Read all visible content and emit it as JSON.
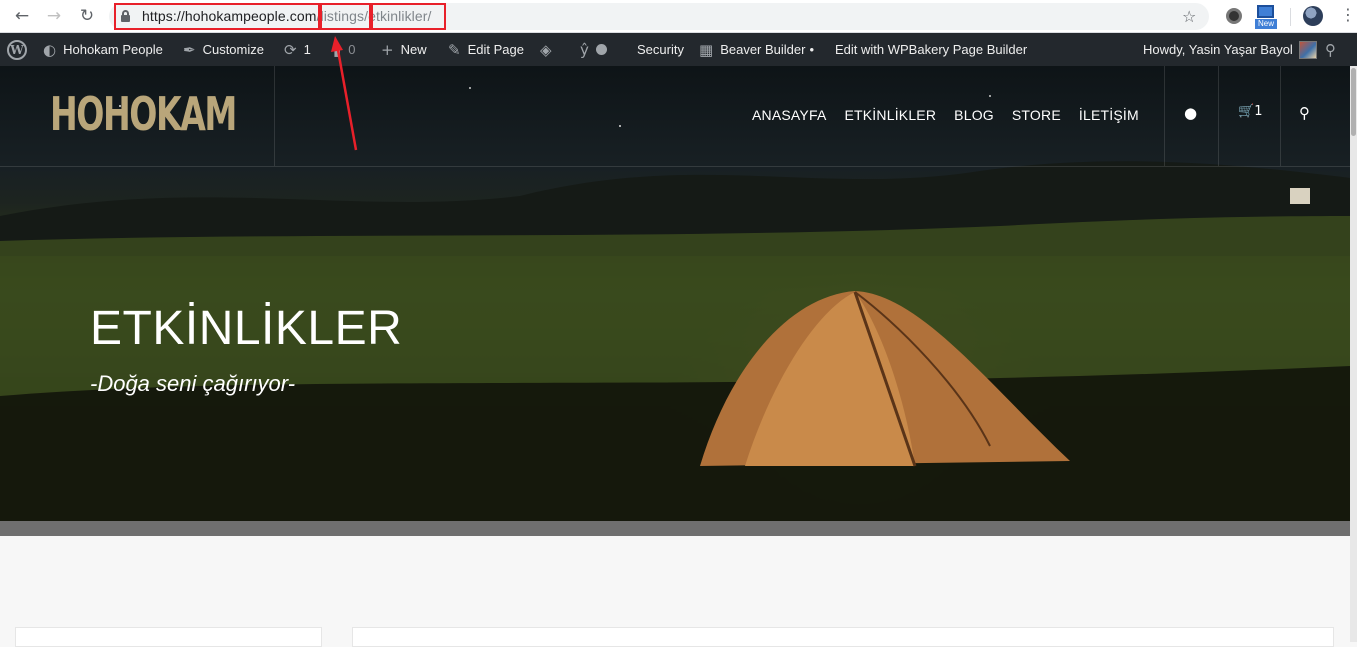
{
  "browser": {
    "back_icon": "arrow-left-icon",
    "forward_icon": "arrow-right-icon",
    "reload_icon": "reload-icon",
    "url_host": "https://hohokampeople.com",
    "url_seg1": "/listings",
    "url_seg2": "/etkinlikler/",
    "new_badge": "New",
    "highlight_color": "#e8202a"
  },
  "adminbar": {
    "site_name": "Hohokam People",
    "customize": "Customize",
    "updates_count": "1",
    "comments_count": "0",
    "new": "New",
    "edit_page": "Edit Page",
    "security": "Security",
    "beaver_builder": "Beaver Builder",
    "wpbakery": "Edit with WPBakery Page Builder",
    "howdy": "Howdy, Yasin Yaşar Bayol"
  },
  "header": {
    "logo": "HOHOKAM",
    "menu": [
      "ANASAYFA",
      "ETKİNLİKLER",
      "BLOG",
      "STORE",
      "İLETİŞİM"
    ],
    "cart_count": "1",
    "logo_color": "#b9a67a"
  },
  "hero": {
    "title": "ETKİNLİKLER",
    "subtitle": "-Doğa seni çağırıyor-"
  }
}
